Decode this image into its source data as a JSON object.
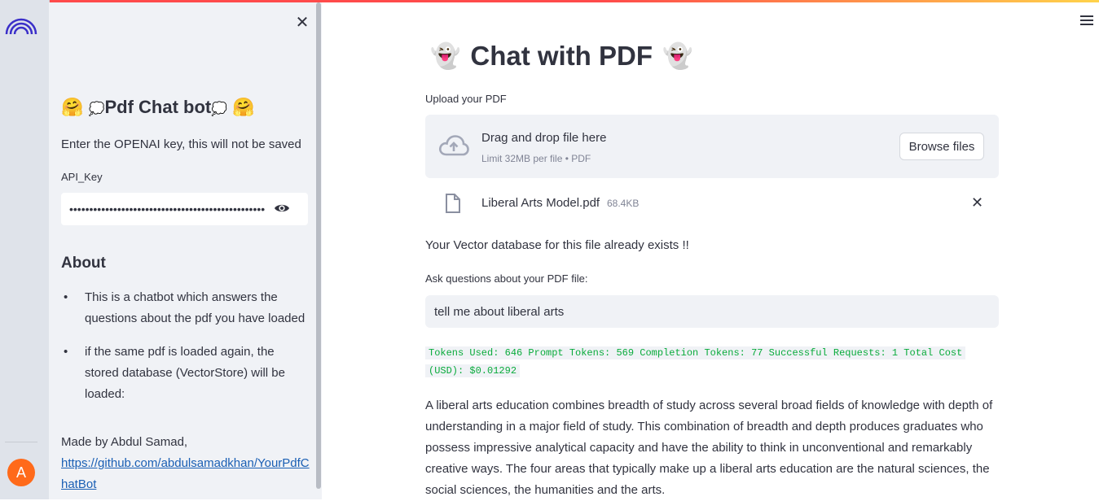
{
  "sidebar": {
    "title_emoji": "🤗",
    "title_bubble": "💭",
    "title_text": "Pdf Chat bot",
    "description": "Enter the OPENAI key, this will not be saved",
    "api_key_label": "API_Key",
    "api_key_value": "••••••••••••••••••••••••••••••••••••••••••••••••••",
    "about_heading": "About",
    "about_items": [
      "This is a chatbot which answers the questions about the pdf you have loaded",
      "if the same pdf is loaded again, the stored database (VectorStore) will be loaded:"
    ],
    "made_by": "Made by Abdul Samad,",
    "github_link": "https://github.com/abdulsamadkhan/YourPdfChatBot"
  },
  "user": {
    "avatar_initial": "A"
  },
  "main": {
    "title": "Chat with PDF",
    "title_emoji": "👻",
    "upload_label": "Upload your PDF",
    "dropzone_text": "Drag and drop file here",
    "dropzone_limit": "Limit 32MB per file • PDF",
    "browse_button": "Browse files",
    "file_name": "Liberal Arts Model.pdf",
    "file_size": "68.4KB",
    "vector_message": "Your Vector database for this file already exists !!",
    "question_label": "Ask questions about your PDF file:",
    "question_value": "tell me about liberal arts",
    "tokens_line1": "Tokens Used: 646 Prompt Tokens: 569 Completion Tokens: 77 Successful Requests: 1 Total Cost",
    "tokens_line2": "(USD): $0.01292",
    "answer": "A liberal arts education combines breadth of study across several broad fields of knowledge with depth of understanding in a major field of study. This combination of breadth and depth produces graduates who possess impressive analytical capacity and have the ability to think in unconventional and remarkably creative ways. The four areas that typically make up a liberal arts education are the natural sciences, the social sciences, the humanities and the arts."
  },
  "colors": {
    "accent": "#ff4b4b",
    "sidebar_bg": "#f0f2f6",
    "rail_bg": "#dfe3ea",
    "avatar_bg": "#ff6a1a",
    "token_text": "#09ab3b",
    "link": "#1a5fb4"
  }
}
